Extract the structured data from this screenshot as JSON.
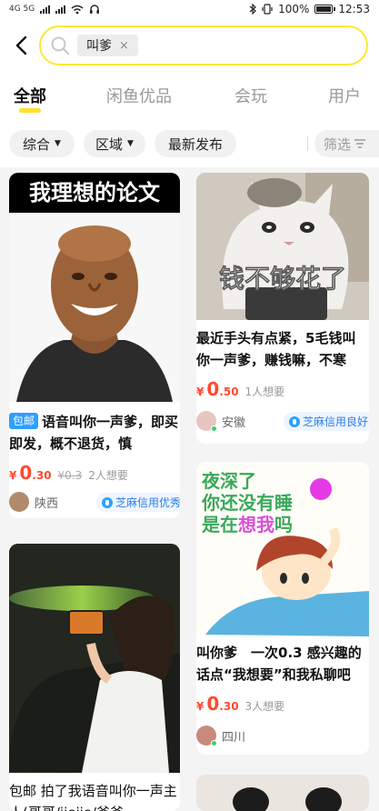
{
  "status_bar": {
    "left": "4G 5G",
    "battery": "100%",
    "time": "12:53"
  },
  "search": {
    "query_chip": "叫爹",
    "clear": "×"
  },
  "tabs": [
    {
      "label": "全部",
      "active": true
    },
    {
      "label": "闲鱼优品",
      "active": false
    },
    {
      "label": "会玩",
      "active": false
    },
    {
      "label": "用户",
      "active": false
    }
  ],
  "filters": {
    "sort": "综合",
    "region": "区域",
    "latest": "最新发布",
    "filter": "筛选"
  },
  "cards": [
    {
      "image_text": "我理想的论文",
      "badge": "包邮",
      "title": "语音叫你一声爹，即买即发，概不退货，慎",
      "price_int": "0",
      "price_dec": ".30",
      "original_price": "¥0.3",
      "want": "2人想要",
      "location": "陕西",
      "credit": "芝麻信用优秀"
    },
    {
      "image_text": "钱不够花了",
      "title": "最近手头有点紧，5毛钱叫你一声爹，赚钱嘛，不寒",
      "price_int": "0",
      "price_dec": ".50",
      "want": "1人想要",
      "location": "安徽",
      "credit": "芝麻信用良好"
    },
    {
      "image_text_line1": "夜深了",
      "image_text_line2": "你还没有睡",
      "image_text_line3_pre": "是在",
      "image_text_line3_hl": "想我",
      "image_text_line3_post": "吗",
      "title": "叫你爹　一次0.3 感兴趣的话点“我想要”和我私聊吧",
      "price_int": "0",
      "price_dec": ".30",
      "want": "3人想要",
      "location": "四川"
    },
    {
      "title": "包邮 拍了我语音叫你一声主人(哥哥/jiejie/爸爸"
    }
  ],
  "currency_symbol": "¥",
  "colors": {
    "accent_yellow": "#ffe12d",
    "price_red": "#ff4a2e",
    "credit_blue": "#2f7fe8"
  }
}
